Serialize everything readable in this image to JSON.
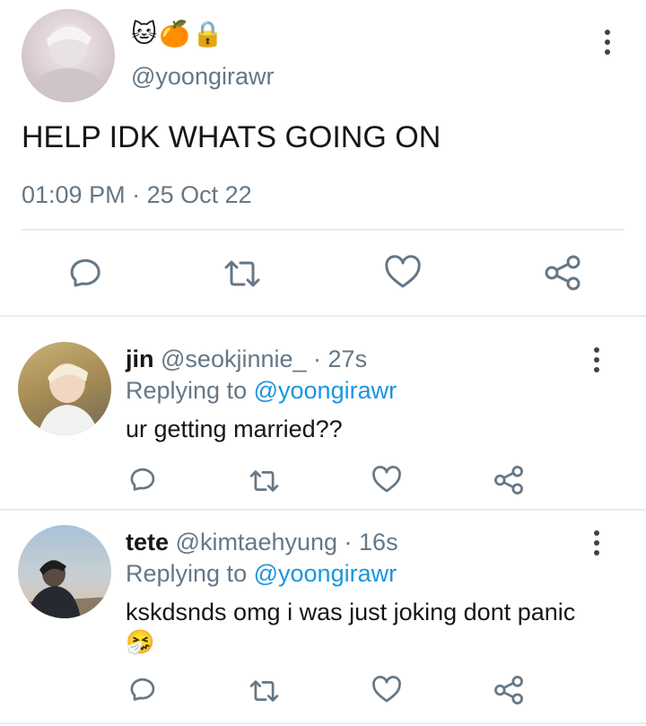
{
  "main_tweet": {
    "display_name_emojis": "🐱🍊🔒",
    "handle": "@yoongirawr",
    "text": "HELP IDK WHATS GOING ON",
    "time": "01:09 PM",
    "separator": "·",
    "date": "25 Oct 22"
  },
  "actions": [
    "reply-icon",
    "retweet-icon",
    "like-icon",
    "share-icon"
  ],
  "replies": [
    {
      "name": "jin",
      "handle": "@seokjinnie_",
      "time": "· 27s",
      "replying_prefix": "Replying to",
      "replying_handle": "@yoongirawr",
      "text": "ur getting married??"
    },
    {
      "name": "tete",
      "handle": "@kimtaehyung",
      "time": "· 16s",
      "replying_prefix": "Replying to",
      "replying_handle": "@yoongirawr",
      "text": "kskdsnds omg i was just joking dont panic",
      "emoji": "🤧"
    }
  ],
  "colors": {
    "link": "#1b95e0",
    "muted": "#657786",
    "icon": "#657786",
    "divider": "#e6ecf0"
  }
}
